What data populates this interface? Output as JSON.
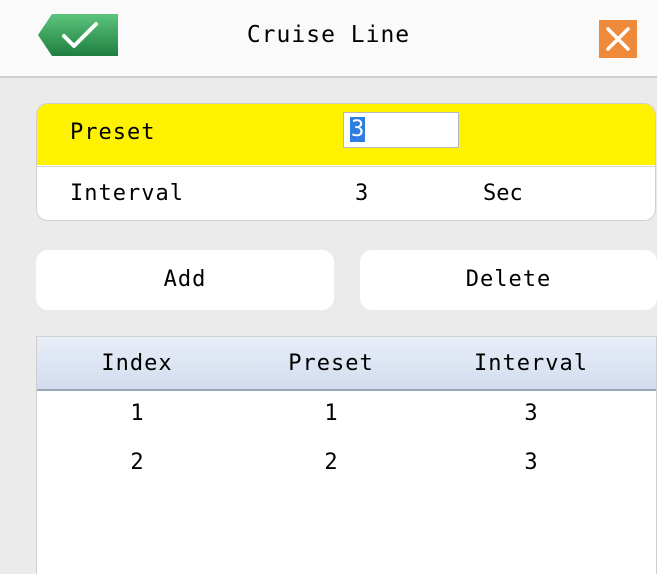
{
  "window": {
    "title": "Cruise Line",
    "accent_ok": "#2e9a52",
    "accent_close": "#ef8a3a"
  },
  "settings": {
    "preset_label": "Preset",
    "preset_value": "3",
    "interval_label": "Interval",
    "interval_value": "3",
    "interval_unit": "Sec",
    "highlight_color": "#fff200"
  },
  "actions": {
    "add_label": "Add",
    "delete_label": "Delete"
  },
  "table": {
    "columns": [
      "Index",
      "Preset",
      "Interval"
    ],
    "rows": [
      [
        "1",
        "1",
        "3"
      ],
      [
        "2",
        "2",
        "3"
      ]
    ]
  }
}
